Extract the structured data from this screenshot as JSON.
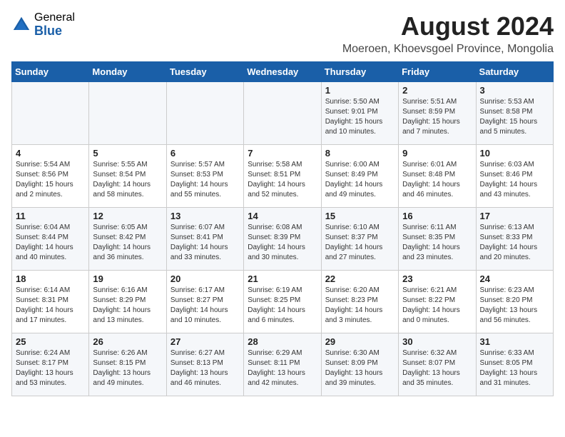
{
  "header": {
    "logo_general": "General",
    "logo_blue": "Blue",
    "month_year": "August 2024",
    "location": "Moeroen, Khoevsgoel Province, Mongolia"
  },
  "weekdays": [
    "Sunday",
    "Monday",
    "Tuesday",
    "Wednesday",
    "Thursday",
    "Friday",
    "Saturday"
  ],
  "weeks": [
    [
      {
        "day": "",
        "info": ""
      },
      {
        "day": "",
        "info": ""
      },
      {
        "day": "",
        "info": ""
      },
      {
        "day": "",
        "info": ""
      },
      {
        "day": "1",
        "info": "Sunrise: 5:50 AM\nSunset: 9:01 PM\nDaylight: 15 hours\nand 10 minutes."
      },
      {
        "day": "2",
        "info": "Sunrise: 5:51 AM\nSunset: 8:59 PM\nDaylight: 15 hours\nand 7 minutes."
      },
      {
        "day": "3",
        "info": "Sunrise: 5:53 AM\nSunset: 8:58 PM\nDaylight: 15 hours\nand 5 minutes."
      }
    ],
    [
      {
        "day": "4",
        "info": "Sunrise: 5:54 AM\nSunset: 8:56 PM\nDaylight: 15 hours\nand 2 minutes."
      },
      {
        "day": "5",
        "info": "Sunrise: 5:55 AM\nSunset: 8:54 PM\nDaylight: 14 hours\nand 58 minutes."
      },
      {
        "day": "6",
        "info": "Sunrise: 5:57 AM\nSunset: 8:53 PM\nDaylight: 14 hours\nand 55 minutes."
      },
      {
        "day": "7",
        "info": "Sunrise: 5:58 AM\nSunset: 8:51 PM\nDaylight: 14 hours\nand 52 minutes."
      },
      {
        "day": "8",
        "info": "Sunrise: 6:00 AM\nSunset: 8:49 PM\nDaylight: 14 hours\nand 49 minutes."
      },
      {
        "day": "9",
        "info": "Sunrise: 6:01 AM\nSunset: 8:48 PM\nDaylight: 14 hours\nand 46 minutes."
      },
      {
        "day": "10",
        "info": "Sunrise: 6:03 AM\nSunset: 8:46 PM\nDaylight: 14 hours\nand 43 minutes."
      }
    ],
    [
      {
        "day": "11",
        "info": "Sunrise: 6:04 AM\nSunset: 8:44 PM\nDaylight: 14 hours\nand 40 minutes."
      },
      {
        "day": "12",
        "info": "Sunrise: 6:05 AM\nSunset: 8:42 PM\nDaylight: 14 hours\nand 36 minutes."
      },
      {
        "day": "13",
        "info": "Sunrise: 6:07 AM\nSunset: 8:41 PM\nDaylight: 14 hours\nand 33 minutes."
      },
      {
        "day": "14",
        "info": "Sunrise: 6:08 AM\nSunset: 8:39 PM\nDaylight: 14 hours\nand 30 minutes."
      },
      {
        "day": "15",
        "info": "Sunrise: 6:10 AM\nSunset: 8:37 PM\nDaylight: 14 hours\nand 27 minutes."
      },
      {
        "day": "16",
        "info": "Sunrise: 6:11 AM\nSunset: 8:35 PM\nDaylight: 14 hours\nand 23 minutes."
      },
      {
        "day": "17",
        "info": "Sunrise: 6:13 AM\nSunset: 8:33 PM\nDaylight: 14 hours\nand 20 minutes."
      }
    ],
    [
      {
        "day": "18",
        "info": "Sunrise: 6:14 AM\nSunset: 8:31 PM\nDaylight: 14 hours\nand 17 minutes."
      },
      {
        "day": "19",
        "info": "Sunrise: 6:16 AM\nSunset: 8:29 PM\nDaylight: 14 hours\nand 13 minutes."
      },
      {
        "day": "20",
        "info": "Sunrise: 6:17 AM\nSunset: 8:27 PM\nDaylight: 14 hours\nand 10 minutes."
      },
      {
        "day": "21",
        "info": "Sunrise: 6:19 AM\nSunset: 8:25 PM\nDaylight: 14 hours\nand 6 minutes."
      },
      {
        "day": "22",
        "info": "Sunrise: 6:20 AM\nSunset: 8:23 PM\nDaylight: 14 hours\nand 3 minutes."
      },
      {
        "day": "23",
        "info": "Sunrise: 6:21 AM\nSunset: 8:22 PM\nDaylight: 14 hours\nand 0 minutes."
      },
      {
        "day": "24",
        "info": "Sunrise: 6:23 AM\nSunset: 8:20 PM\nDaylight: 13 hours\nand 56 minutes."
      }
    ],
    [
      {
        "day": "25",
        "info": "Sunrise: 6:24 AM\nSunset: 8:17 PM\nDaylight: 13 hours\nand 53 minutes."
      },
      {
        "day": "26",
        "info": "Sunrise: 6:26 AM\nSunset: 8:15 PM\nDaylight: 13 hours\nand 49 minutes."
      },
      {
        "day": "27",
        "info": "Sunrise: 6:27 AM\nSunset: 8:13 PM\nDaylight: 13 hours\nand 46 minutes."
      },
      {
        "day": "28",
        "info": "Sunrise: 6:29 AM\nSunset: 8:11 PM\nDaylight: 13 hours\nand 42 minutes."
      },
      {
        "day": "29",
        "info": "Sunrise: 6:30 AM\nSunset: 8:09 PM\nDaylight: 13 hours\nand 39 minutes."
      },
      {
        "day": "30",
        "info": "Sunrise: 6:32 AM\nSunset: 8:07 PM\nDaylight: 13 hours\nand 35 minutes."
      },
      {
        "day": "31",
        "info": "Sunrise: 6:33 AM\nSunset: 8:05 PM\nDaylight: 13 hours\nand 31 minutes."
      }
    ]
  ]
}
